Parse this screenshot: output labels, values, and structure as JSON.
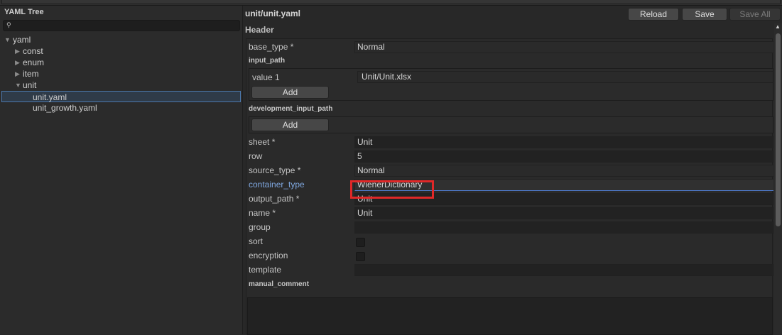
{
  "left_panel": {
    "title": "YAML Tree",
    "search": {
      "icon": "search-icon",
      "placeholder": "",
      "value": ""
    },
    "tree": [
      {
        "label": "yaml",
        "depth": 0,
        "expanded": true,
        "has_arrow": true
      },
      {
        "label": "const",
        "depth": 1,
        "expanded": false,
        "has_arrow": true
      },
      {
        "label": "enum",
        "depth": 1,
        "expanded": false,
        "has_arrow": true
      },
      {
        "label": "item",
        "depth": 1,
        "expanded": false,
        "has_arrow": true
      },
      {
        "label": "unit",
        "depth": 1,
        "expanded": true,
        "has_arrow": true
      },
      {
        "label": "unit.yaml",
        "depth": 2,
        "selected": true,
        "has_arrow": false
      },
      {
        "label": "unit_growth.yaml",
        "depth": 2,
        "selected": false,
        "has_arrow": false
      }
    ]
  },
  "right_panel": {
    "file_title": "unit/unit.yaml",
    "buttons": {
      "reload": "Reload",
      "save": "Save",
      "save_all": "Save All"
    },
    "header_label": "Header",
    "fields": {
      "base_type": {
        "label": "base_type *",
        "value": "Normal"
      },
      "input_path": {
        "section": "input_path",
        "items": [
          {
            "label": "value 1",
            "value": "Unit/Unit.xlsx"
          }
        ],
        "add_label": "Add"
      },
      "development_input_path": {
        "section": "development_input_path",
        "add_label": "Add"
      },
      "sheet": {
        "label": "sheet *",
        "value": "Unit"
      },
      "row": {
        "label": "row",
        "value": "5"
      },
      "source_type": {
        "label": "source_type *",
        "value": "Normal"
      },
      "container_type": {
        "label": "container_type",
        "value": "WienerDictionary"
      },
      "output_path": {
        "label": "output_path *",
        "value": "Unit"
      },
      "name": {
        "label": "name *",
        "value": "Unit"
      },
      "group": {
        "label": "group",
        "value": ""
      },
      "sort": {
        "label": "sort",
        "checked": false
      },
      "encryption": {
        "label": "encryption",
        "checked": false
      },
      "template": {
        "label": "template",
        "value": ""
      },
      "manual_comment": {
        "section": "manual_comment",
        "value": ""
      }
    }
  },
  "colors": {
    "highlight": "#e02828",
    "accent_label": "#7fa7df",
    "selection_border": "#4d7ab0"
  }
}
